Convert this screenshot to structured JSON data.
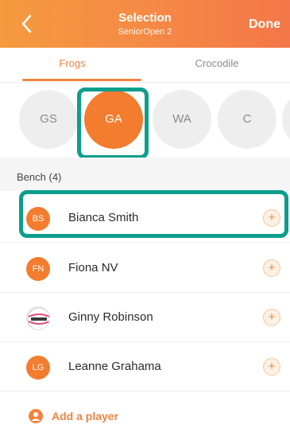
{
  "header": {
    "title": "Selection",
    "subtitle": "SeniorOpen 2",
    "done_label": "Done"
  },
  "tabs": [
    {
      "label": "Frogs",
      "active": true
    },
    {
      "label": "Crocodile",
      "active": false
    }
  ],
  "positions": [
    {
      "label": "GS",
      "active": false
    },
    {
      "label": "GA",
      "active": true
    },
    {
      "label": "WA",
      "active": false
    },
    {
      "label": "C",
      "active": false
    },
    {
      "label": "",
      "active": false
    }
  ],
  "bench": {
    "label": "Bench",
    "count": "(4)"
  },
  "players": [
    {
      "initials": "BS",
      "name": "Bianca Smith",
      "add_label": "+"
    },
    {
      "initials": "FN",
      "name": "Fiona NV",
      "add_label": "+"
    },
    {
      "initials": "",
      "name": "Ginny Robinson",
      "add_label": "+",
      "avatar_icon": "netball-icon"
    },
    {
      "initials": "LG",
      "name": "Leanne Grahama",
      "add_label": "+"
    }
  ],
  "add_player": {
    "label": "Add a player"
  },
  "colors": {
    "accent": "#f37c2e",
    "highlight": "#0c9e8c"
  }
}
